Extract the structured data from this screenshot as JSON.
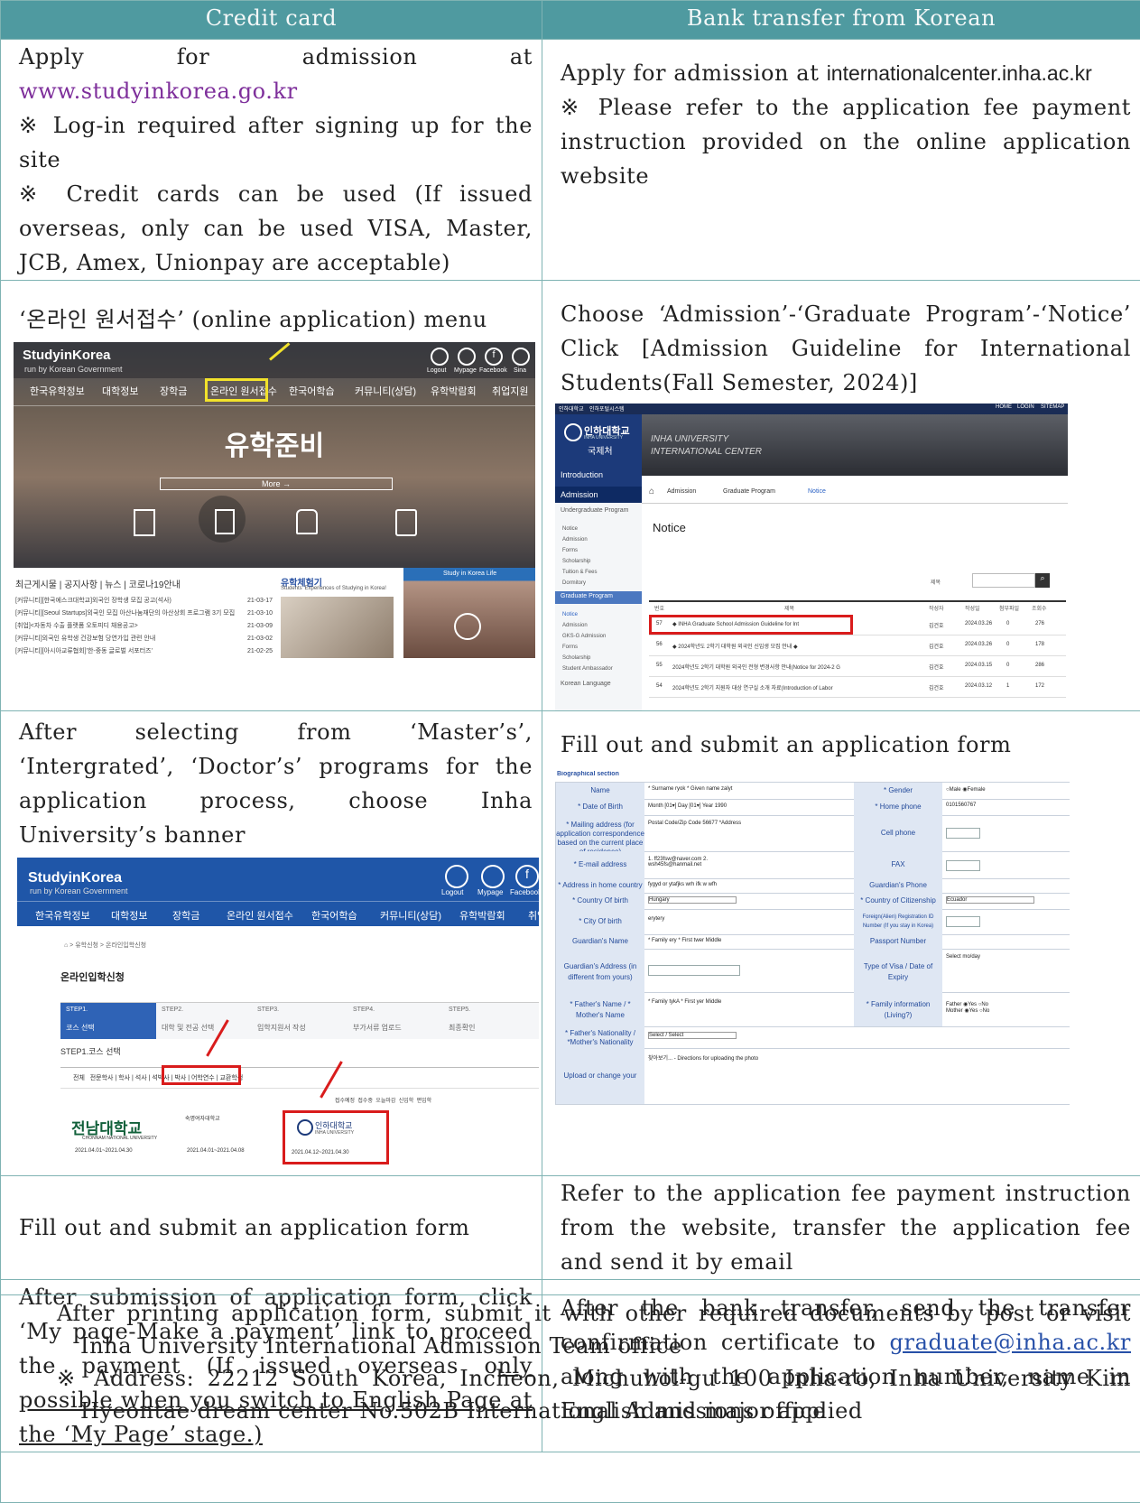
{
  "headers": {
    "credit": "Credit card",
    "bank": "Bank transfer from Korean"
  },
  "row1": {
    "left_prefix": "Apply for admission at ",
    "left_url": "www.studyinkorea.go.kr",
    "left_note1": "※ Log-in required after signing up for the site",
    "left_note2": "※ Credit cards can be used (If issued overseas, only can be used VISA, Master, JCB, Amex, Unionpay are acceptable)",
    "right_prefix": "Apply for admission at ",
    "right_url": "internationalcenter.inha.ac.kr",
    "right_note": "※ Please refer to the application fee payment instruction provided on the online application website"
  },
  "row2": {
    "left_text": "‘온라인 원서접수’ (online application) menu",
    "right_text": "Choose ‘Admission’-‘Graduate Program’-‘Notice’ Click [Admission Guideline for International Students(Fall Semester, 2024)]"
  },
  "sik1": {
    "logo": "StudyinKorea",
    "logo_sub": "run by Korean Government",
    "top_icons": [
      "Logout",
      "Mypage",
      "Facebook",
      "Sina"
    ],
    "nav": [
      "한국유학정보",
      "대학정보",
      "장학금",
      "온라인 원서접수",
      "한국어학습",
      "커뮤니티(상담)",
      "유학박람회",
      "취업지원"
    ],
    "hero_title": "유학준비",
    "more": "More →",
    "news_tabs": "최근게시물 | 공지사항 | 뉴스 | 코로나19안내",
    "news": [
      {
        "t": "[커뮤니티][한국에스크대학교]외국인 장학생 모집 공고(석사)",
        "d": "21-03-17"
      },
      {
        "t": "[커뮤니티][Seoul Startups]외국인 모집 아산나눔재단의 아산상회 프로그램 3기 모집",
        "d": "21-03-10"
      },
      {
        "t": "[취업]<자동차 수출 플랫폼 오토피디 채용공고>",
        "d": "21-03-09"
      },
      {
        "t": "[커뮤니티]외국인 유학생 건강보험 당연가입 관련 안내",
        "d": "21-03-02"
      },
      {
        "t": "[커뮤니티][아시아교류협회]'한-중동 글로벌 서포터즈'",
        "d": "21-02-25"
      }
    ],
    "exp_title": "유학체험기",
    "exp_sub": "Students' Experiences of Studying in Korea!",
    "life": "Study in Korea Life"
  },
  "inha": {
    "top_tabs": [
      "인하대학교",
      "인하포털시스템"
    ],
    "top_right": [
      "HOME",
      "LOGIN",
      "SITEMAP"
    ],
    "logo": "인하대학교",
    "logo_en": "INHA UNIVERSITY",
    "logo_sub": "국제처",
    "banner1": "INHA UNIVERSITY",
    "banner2": "INTERNATIONAL CENTER",
    "side": [
      "Introduction",
      "Admission",
      "Undergraduate Program"
    ],
    "side_sub1": [
      "Notice",
      "Admission",
      "Forms",
      "Scholarship",
      "Tuition & Fees",
      "Dormitory"
    ],
    "side_grad": "Graduate Program",
    "side_sub2": [
      "Notice",
      "Admission",
      "GKS-G Admission",
      "Forms",
      "Scholarship",
      "Student Ambassador"
    ],
    "side_lang": "Korean Language",
    "crumbs": [
      "Admission",
      "Graduate Program",
      "Notice"
    ],
    "title": "Notice",
    "search_label": "제목",
    "cols": [
      "번호",
      "제목",
      "작성자",
      "작성일",
      "첨부파일",
      "조회수"
    ],
    "rows": [
      {
        "no": "57",
        "t": "◆ INHA Graduate School Admission Guideline for Int",
        "w": "김건호",
        "d": "2024.03.26",
        "a": "0",
        "v": "276"
      },
      {
        "no": "56",
        "t": "◆ 2024학년도 2학기 대학원 외국인 신입생 모집 안내 ◆",
        "w": "김건호",
        "d": "2024.03.26",
        "a": "0",
        "v": "178"
      },
      {
        "no": "55",
        "t": "2024학년도 2학기 대학원 외국인 전형 변경사항 안내(Notice for 2024-2 G",
        "w": "김건호",
        "d": "2024.03.15",
        "a": "0",
        "v": "286"
      },
      {
        "no": "54",
        "t": "2024학년도 2학기 지원자 대상 연구실 소개 자료(Introduction of Labor",
        "w": "김건호",
        "d": "2024.03.12",
        "a": "1",
        "v": "172"
      }
    ]
  },
  "row3": {
    "left_text": "After selecting from ‘Master’s’, ‘Intergrated’, ‘Doctor’s’ programs for the application process, choose Inha University’s banner",
    "right_text": "Fill out and submit an application form"
  },
  "sik2": {
    "logo": "StudyinKorea",
    "logo_sub": "run by Korean Government",
    "icons": [
      "Logout",
      "Mypage",
      "Facebook"
    ],
    "nav": [
      "한국유학정보",
      "대학정보",
      "장학금",
      "온라인 원서접수",
      "한국어학습",
      "커뮤니티(상담)",
      "유학박람회",
      "취업"
    ],
    "crumb": "⌂ > 유학신청 > 온라인입학신청",
    "page_title": "온라인입학신청",
    "steps": [
      {
        "n": "STEP1.",
        "l": "코스 선택"
      },
      {
        "n": "STEP2.",
        "l": "대학 및 전공 선택"
      },
      {
        "n": "STEP3.",
        "l": "입학지원서 작성"
      },
      {
        "n": "STEP4.",
        "l": "부가서류 업로드"
      },
      {
        "n": "STEP5.",
        "l": "최종확인"
      }
    ],
    "step_head": "STEP1.코스 선택",
    "filters": "전체   전문학사 | 학사 | 석사 | 석박사 | 박사 | 어학연수 | 교환학생",
    "legend": "접수예정  접수중  오늘마감  신입학  편입학",
    "uni1": "전남대학교",
    "uni1_en": "CHONNAM NATIONAL UNIVERSITY",
    "uni1_date": "2021.04.01~2021.04.30",
    "uni2": "숙명여자대학교",
    "uni2_date": "2021.04.01~2021.04.08",
    "uni3": "인하대학교",
    "uni3_en": "INHA UNIVERSITY",
    "uni3_date": "2021.04.12~2021.04.30"
  },
  "form": {
    "section": "Biographical section",
    "rows": [
      {
        "l": "Name",
        "v": "* Surname  ryok   * Given name  zalyt",
        "rl": "* Gender",
        "rv": "○Male ◉Female"
      },
      {
        "l": "* Date of Birth",
        "v": "Month [01▾] Day [01▾] Year 1990",
        "rl": "* Home phone",
        "rv": "0101560767"
      },
      {
        "l": "* Mailing address (for application correspondence based on the current place of residence)",
        "v": "Postal Code/Zip Code 56677 *Address",
        "rl": "Cell phone",
        "rv": ""
      },
      {
        "l": "* E-mail address",
        "v": "1. ff23fsw@naver.com  2. wsh45fs@hanmail.net",
        "rl": "FAX",
        "rv": ""
      },
      {
        "l": "* Address in home country",
        "v": "fygyd or ytafjks wrh ifk w wfh",
        "rl": "Guardian's Phone",
        "rv": ""
      },
      {
        "l": "* Country Of birth",
        "v": "Hungary",
        "rl": "* Country of Citizenship",
        "rv": "Ecuador"
      },
      {
        "l": "* City Of birth",
        "v": "erytery",
        "rl": "Foreign(Alien) Registration ID Number (If you stay in Korea)",
        "rv": ""
      },
      {
        "l": "Guardian's Name",
        "v": "* Family  ery   * First  twer   Middle",
        "rl": "Passport Number",
        "rv": ""
      },
      {
        "l": "Guardian's Address (in different from yours)",
        "v": "",
        "rl": "Type of Visa / Date of Expiry",
        "rv": "Select  mo/day"
      },
      {
        "l": "* Father's Name / * Mother's Name",
        "v": "* Family  tykA  * First  yer  Middle",
        "rl": "* Family information (Living?)",
        "rv": "Father ◉Yes ○No  Mother ◉Yes ○No"
      },
      {
        "l": "* Father's Nationality / *Mother's Nationality",
        "v": "Select / Select",
        "rl": "",
        "rv": ""
      },
      {
        "l": "Upload or change your photo",
        "v": "찾아보기... - Directions for uploading the photo",
        "rl": "",
        "rv": ""
      }
    ]
  },
  "row4": {
    "left_text": "Fill out and submit an application form",
    "right_text": "Refer to the application fee payment instruction from the website, transfer the application fee and send it by email"
  },
  "row5": {
    "left_a": "After submission of application form, click ‘My page-Make a payment’ link to proceed the payment (If issued overseas o",
    "left_b": "nly possible when you switch to English Page at the ‘My Page’ stage.)",
    "right_a": "After the bank transfer, send the transfer confirmation certificate to ",
    "right_email": "graduate@inha.ac.kr",
    "right_b": " along with the application number, name in English and major applied"
  },
  "bottom": {
    "line1": "After printing application form, submit it with other required documents by post or visit Inha University International Admission Team office",
    "line2": "※ Address: 22212 South Korea, Incheon, Michuhol-gu 100 Inha-ro, Inha University Kim Hyeontae dream center No.502B International Admissions office"
  }
}
